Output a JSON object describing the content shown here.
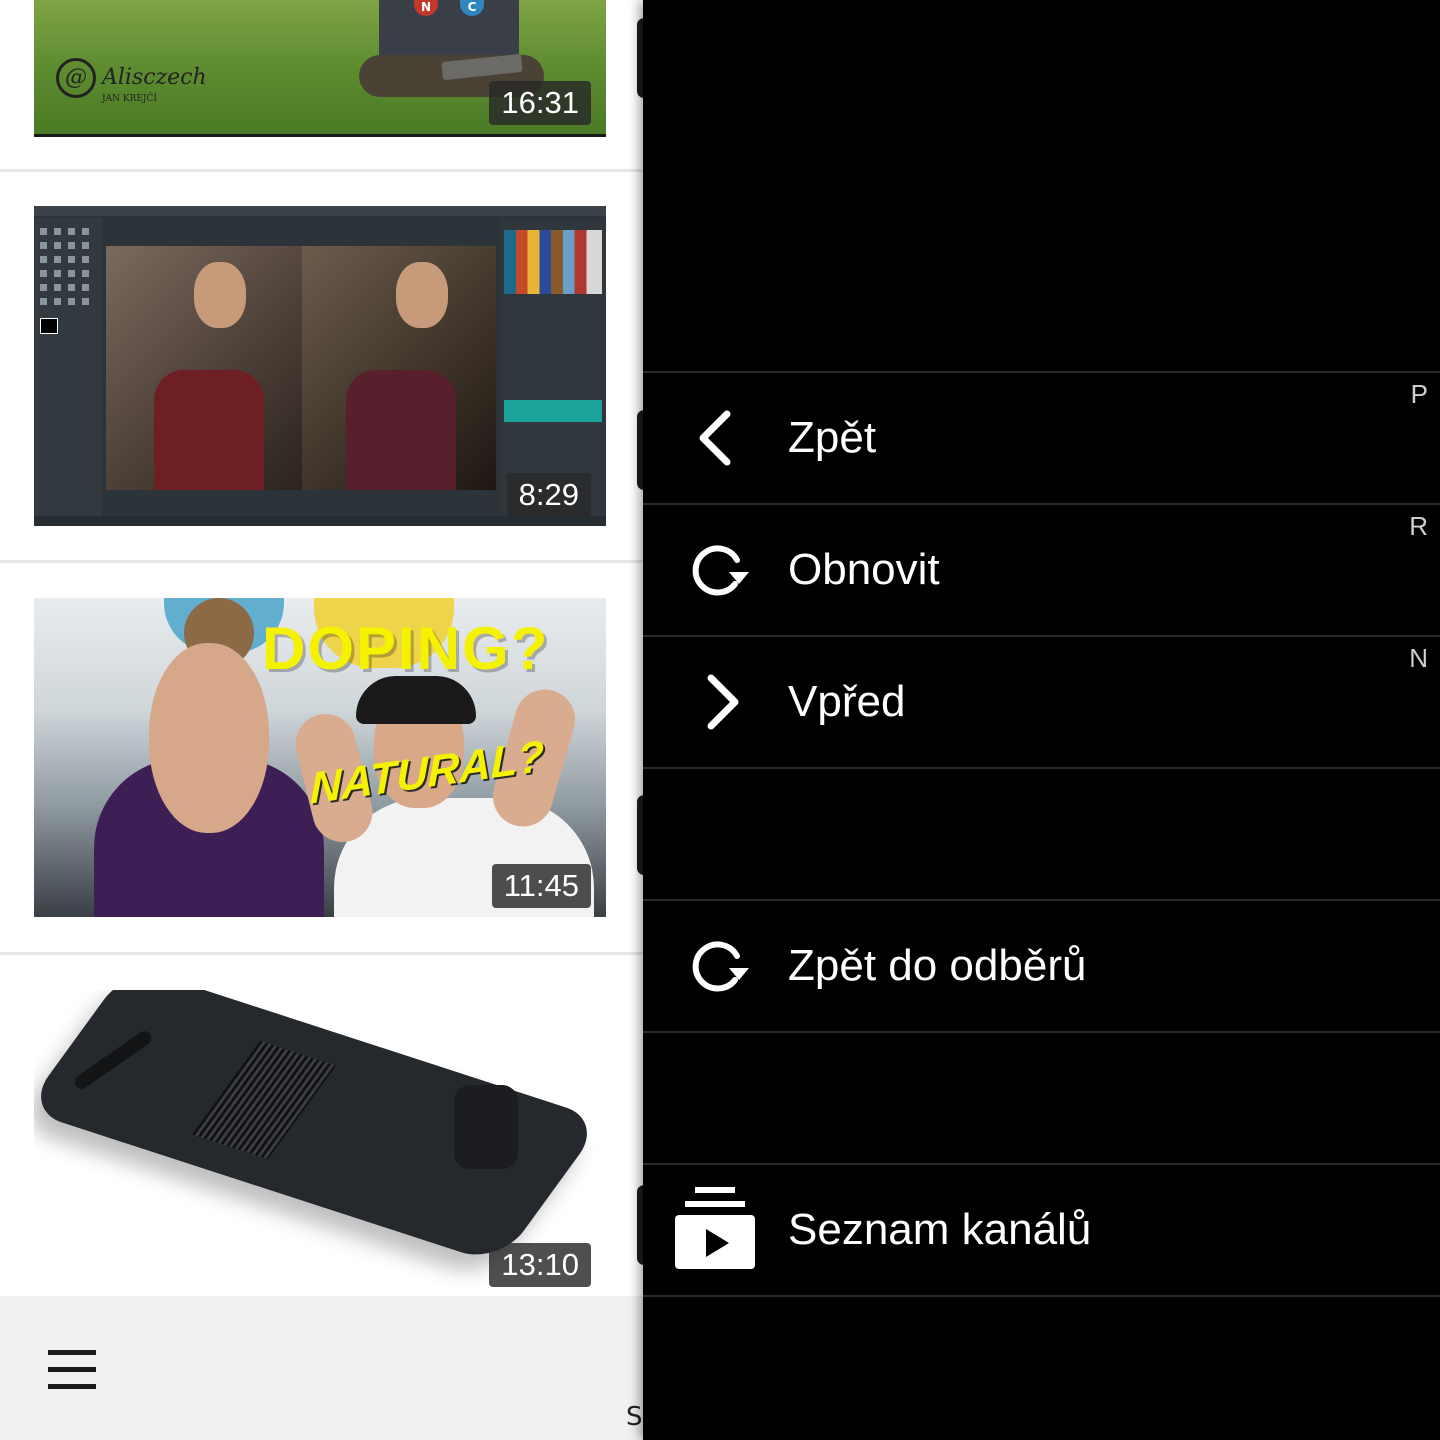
{
  "feed": {
    "videos": [
      {
        "duration": "16:31",
        "channel_logo_text": "Alisczech",
        "channel_logo_subtext": "JAN KREJČÍ"
      },
      {
        "duration": "8:29"
      },
      {
        "duration": "11:45",
        "headline": "DOPING?",
        "subline": "NATURAL?"
      },
      {
        "duration": "13:10"
      }
    ]
  },
  "bottom_bar": {
    "menu_icon": "hamburger-menu-icon",
    "partial_letter": "S"
  },
  "drawer": {
    "items": [
      {
        "label": "Zpět",
        "shortcut": "P",
        "icon": "chevron-left-icon"
      },
      {
        "label": "Obnovit",
        "shortcut": "R",
        "icon": "refresh-icon"
      },
      {
        "label": "Vpřed",
        "shortcut": "N",
        "icon": "chevron-right-icon"
      },
      {
        "label": "Zpět do odběrů",
        "shortcut": "",
        "icon": "refresh-icon"
      },
      {
        "label": "Seznam kanálů",
        "shortcut": "",
        "icon": "subscriptions-icon"
      }
    ]
  },
  "colors": {
    "drawer_bg": "#000000",
    "drawer_text": "#ffffff",
    "feed_bg": "#ffffff",
    "bottom_bar_bg": "#f0f0f0"
  }
}
